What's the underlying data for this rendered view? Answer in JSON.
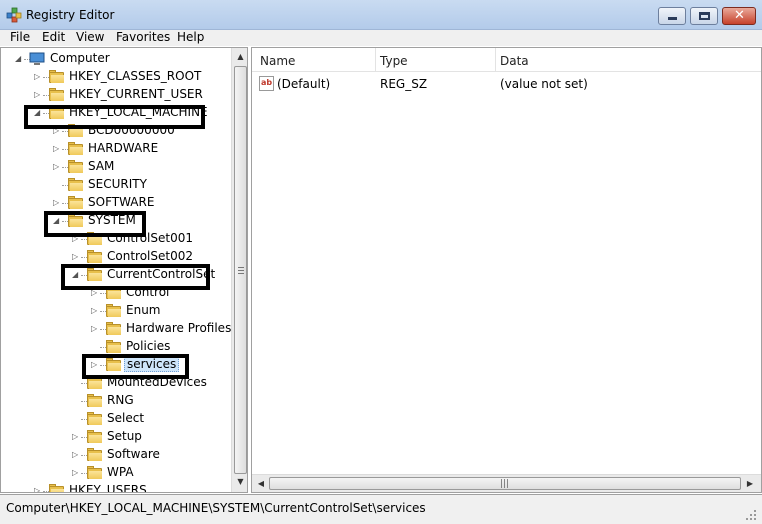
{
  "window": {
    "title": "Registry Editor"
  },
  "menu": [
    "File",
    "Edit",
    "View",
    "Favorites",
    "Help"
  ],
  "tree": [
    {
      "label": "Computer",
      "level": 0,
      "expander": "open",
      "icon": "computer-icon"
    },
    {
      "label": "HKEY_CLASSES_ROOT",
      "level": 1,
      "expander": "closed"
    },
    {
      "label": "HKEY_CURRENT_USER",
      "level": 1,
      "expander": "closed"
    },
    {
      "label": "HKEY_LOCAL_MACHINE",
      "level": 1,
      "expander": "open"
    },
    {
      "label": "BCD00000000",
      "level": 2,
      "expander": "closed"
    },
    {
      "label": "HARDWARE",
      "level": 2,
      "expander": "closed"
    },
    {
      "label": "SAM",
      "level": 2,
      "expander": "closed"
    },
    {
      "label": "SECURITY",
      "level": 2,
      "expander": "none"
    },
    {
      "label": "SOFTWARE",
      "level": 2,
      "expander": "closed"
    },
    {
      "label": "SYSTEM",
      "level": 2,
      "expander": "open"
    },
    {
      "label": "ControlSet001",
      "level": 3,
      "expander": "closed"
    },
    {
      "label": "ControlSet002",
      "level": 3,
      "expander": "closed"
    },
    {
      "label": "CurrentControlSet",
      "level": 3,
      "expander": "open"
    },
    {
      "label": "Control",
      "level": 4,
      "expander": "closed"
    },
    {
      "label": "Enum",
      "level": 4,
      "expander": "closed"
    },
    {
      "label": "Hardware Profiles",
      "level": 4,
      "expander": "closed"
    },
    {
      "label": "Policies",
      "level": 4,
      "expander": "none"
    },
    {
      "label": "services",
      "level": 4,
      "expander": "closed",
      "selected": true
    },
    {
      "label": "MountedDevices",
      "level": 3,
      "expander": "none"
    },
    {
      "label": "RNG",
      "level": 3,
      "expander": "none"
    },
    {
      "label": "Select",
      "level": 3,
      "expander": "none"
    },
    {
      "label": "Setup",
      "level": 3,
      "expander": "closed"
    },
    {
      "label": "Software",
      "level": 3,
      "expander": "closed"
    },
    {
      "label": "WPA",
      "level": 3,
      "expander": "closed"
    },
    {
      "label": "HKEY_USERS",
      "level": 1,
      "expander": "closed"
    }
  ],
  "list": {
    "columns": [
      "Name",
      "Type",
      "Data"
    ],
    "rows": [
      {
        "name": "(Default)",
        "type": "REG_SZ",
        "data": "(value not set)",
        "icon": "string-value-icon"
      }
    ]
  },
  "status": {
    "path": "Computer\\HKEY_LOCAL_MACHINE\\SYSTEM\\CurrentControlSet\\services"
  },
  "colors": {
    "highlight_box": "#000000",
    "selection": "#cfe6fb",
    "folder": "#e8c04c"
  }
}
